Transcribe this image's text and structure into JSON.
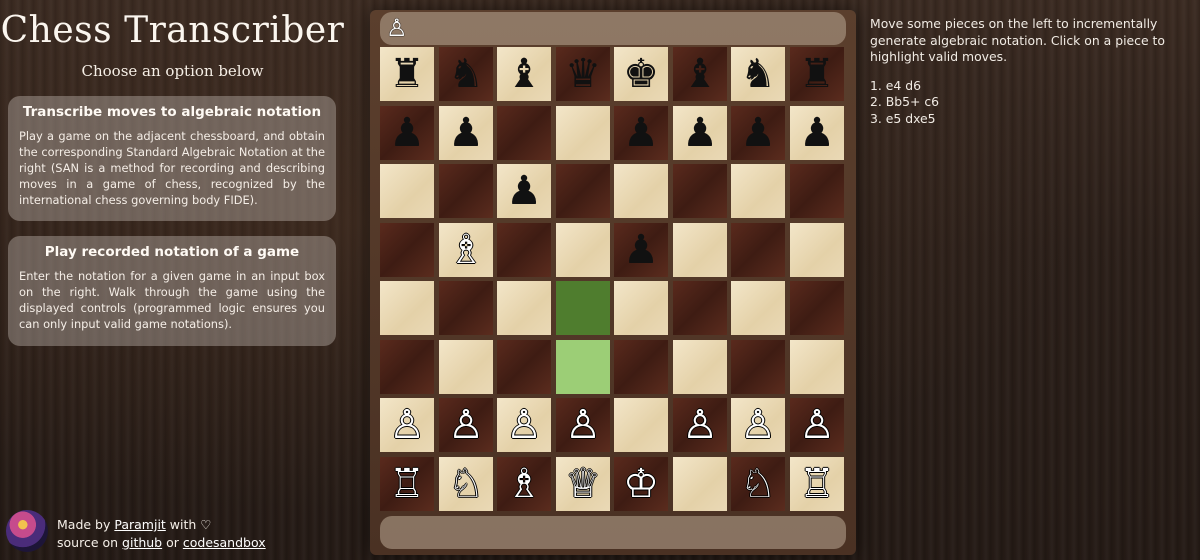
{
  "app": {
    "title": "Chess Transcriber",
    "subtitle": "Choose an option below"
  },
  "options": [
    {
      "title": "Transcribe moves to algebraic notation",
      "description": "Play a game on the adjacent chessboard, and obtain the corresponding Standard Algebraic Notation at the right (SAN is a method for recording and describing moves in a game of chess, recognized by the international chess governing body FIDE)."
    },
    {
      "title": "Play recorded notation of a game",
      "description": "Enter the notation for a given game in an input box on the right. Walk through the game using the displayed controls (programmed logic ensures you can only input valid game notations)."
    }
  ],
  "footer": {
    "made_by_prefix": "Made by ",
    "author": "Paramjit",
    "made_by_suffix": " with ♡",
    "source_prefix": "source on ",
    "github": "github",
    "or": " or ",
    "codesandbox": "codesandbox"
  },
  "captured_top": [
    "♙"
  ],
  "captured_bottom": [],
  "board": [
    [
      {
        "p": "♜",
        "c": "b",
        "light": true
      },
      {
        "p": "♞",
        "c": "b",
        "light": false
      },
      {
        "p": "♝",
        "c": "b",
        "light": true
      },
      {
        "p": "♛",
        "c": "b",
        "light": false
      },
      {
        "p": "♚",
        "c": "b",
        "light": true
      },
      {
        "p": "♝",
        "c": "b",
        "light": false
      },
      {
        "p": "♞",
        "c": "b",
        "light": true
      },
      {
        "p": "♜",
        "c": "b",
        "light": false
      }
    ],
    [
      {
        "p": "♟",
        "c": "b",
        "light": false
      },
      {
        "p": "♟",
        "c": "b",
        "light": true
      },
      {
        "p": "",
        "c": "",
        "light": false
      },
      {
        "p": "",
        "c": "",
        "light": true
      },
      {
        "p": "♟",
        "c": "b",
        "light": false
      },
      {
        "p": "♟",
        "c": "b",
        "light": true
      },
      {
        "p": "♟",
        "c": "b",
        "light": false
      },
      {
        "p": "♟",
        "c": "b",
        "light": true
      }
    ],
    [
      {
        "p": "",
        "c": "",
        "light": true
      },
      {
        "p": "",
        "c": "",
        "light": false
      },
      {
        "p": "♟",
        "c": "b",
        "light": true
      },
      {
        "p": "",
        "c": "",
        "light": false
      },
      {
        "p": "",
        "c": "",
        "light": true
      },
      {
        "p": "",
        "c": "",
        "light": false
      },
      {
        "p": "",
        "c": "",
        "light": true
      },
      {
        "p": "",
        "c": "",
        "light": false
      }
    ],
    [
      {
        "p": "",
        "c": "",
        "light": false
      },
      {
        "p": "♗",
        "c": "w",
        "light": true
      },
      {
        "p": "",
        "c": "",
        "light": false
      },
      {
        "p": "",
        "c": "",
        "light": true
      },
      {
        "p": "♟",
        "c": "b",
        "light": false
      },
      {
        "p": "",
        "c": "",
        "light": true
      },
      {
        "p": "",
        "c": "",
        "light": false
      },
      {
        "p": "",
        "c": "",
        "light": true
      }
    ],
    [
      {
        "p": "",
        "c": "",
        "light": true
      },
      {
        "p": "",
        "c": "",
        "light": false
      },
      {
        "p": "",
        "c": "",
        "light": true
      },
      {
        "p": "",
        "c": "",
        "light": false,
        "hl": true
      },
      {
        "p": "",
        "c": "",
        "light": true
      },
      {
        "p": "",
        "c": "",
        "light": false
      },
      {
        "p": "",
        "c": "",
        "light": true
      },
      {
        "p": "",
        "c": "",
        "light": false
      }
    ],
    [
      {
        "p": "",
        "c": "",
        "light": false
      },
      {
        "p": "",
        "c": "",
        "light": true
      },
      {
        "p": "",
        "c": "",
        "light": false
      },
      {
        "p": "",
        "c": "",
        "light": true,
        "hl": true
      },
      {
        "p": "",
        "c": "",
        "light": false
      },
      {
        "p": "",
        "c": "",
        "light": true
      },
      {
        "p": "",
        "c": "",
        "light": false
      },
      {
        "p": "",
        "c": "",
        "light": true
      }
    ],
    [
      {
        "p": "♙",
        "c": "w",
        "light": true
      },
      {
        "p": "♙",
        "c": "w",
        "light": false
      },
      {
        "p": "♙",
        "c": "w",
        "light": true
      },
      {
        "p": "♙",
        "c": "w",
        "light": false
      },
      {
        "p": "",
        "c": "",
        "light": true
      },
      {
        "p": "♙",
        "c": "w",
        "light": false
      },
      {
        "p": "♙",
        "c": "w",
        "light": true
      },
      {
        "p": "♙",
        "c": "w",
        "light": false
      }
    ],
    [
      {
        "p": "♖",
        "c": "w",
        "light": false
      },
      {
        "p": "♘",
        "c": "w",
        "light": true
      },
      {
        "p": "♗",
        "c": "w",
        "light": false
      },
      {
        "p": "♕",
        "c": "w",
        "light": true
      },
      {
        "p": "♔",
        "c": "w",
        "light": false
      },
      {
        "p": "",
        "c": "",
        "light": true
      },
      {
        "p": "♘",
        "c": "w",
        "light": false
      },
      {
        "p": "♖",
        "c": "w",
        "light": true
      }
    ]
  ],
  "notation": {
    "instructions": "Move some pieces on the left to incrementally generate algebraic notation. Click on a piece to highlight valid moves.",
    "moves": [
      "1. e4 d6",
      "2. Bb5+ c6",
      "3. e5 dxe5"
    ]
  },
  "colors": {
    "highlight_dark": "#4f7d2e",
    "highlight_light": "#9cce76"
  }
}
